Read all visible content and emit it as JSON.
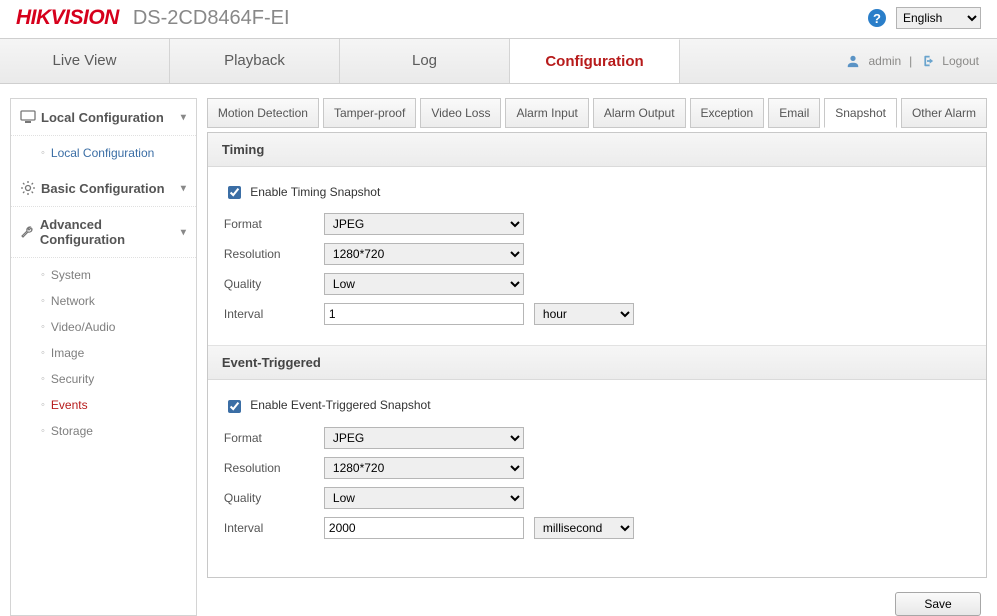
{
  "header": {
    "logo": "HIKVISION",
    "model": "DS-2CD8464F-EI",
    "language": "English",
    "help_tooltip": "?"
  },
  "nav": {
    "tabs": [
      "Live View",
      "Playback",
      "Log",
      "Configuration"
    ],
    "active_index": 3,
    "user": "admin",
    "logout": "Logout"
  },
  "sidebar": {
    "sections": [
      {
        "label": "Local Configuration",
        "items": [
          {
            "label": "Local Configuration",
            "link": true
          }
        ]
      },
      {
        "label": "Basic Configuration",
        "items": []
      },
      {
        "label": "Advanced Configuration",
        "items": [
          {
            "label": "System"
          },
          {
            "label": "Network"
          },
          {
            "label": "Video/Audio"
          },
          {
            "label": "Image"
          },
          {
            "label": "Security"
          },
          {
            "label": "Events",
            "active": true
          },
          {
            "label": "Storage"
          }
        ]
      }
    ]
  },
  "subtabs": {
    "items": [
      "Motion Detection",
      "Tamper-proof",
      "Video Loss",
      "Alarm Input",
      "Alarm Output",
      "Exception",
      "Email",
      "Snapshot",
      "Other Alarm"
    ],
    "active_index": 7
  },
  "sections": {
    "timing": {
      "title": "Timing",
      "enable_label": "Enable Timing Snapshot",
      "enable_checked": true,
      "format_label": "Format",
      "format_value": "JPEG",
      "resolution_label": "Resolution",
      "resolution_value": "1280*720",
      "quality_label": "Quality",
      "quality_value": "Low",
      "interval_label": "Interval",
      "interval_value": "1",
      "interval_unit": "hour"
    },
    "event": {
      "title": "Event-Triggered",
      "enable_label": "Enable Event-Triggered Snapshot",
      "enable_checked": true,
      "format_label": "Format",
      "format_value": "JPEG",
      "resolution_label": "Resolution",
      "resolution_value": "1280*720",
      "quality_label": "Quality",
      "quality_value": "Low",
      "interval_label": "Interval",
      "interval_value": "2000",
      "interval_unit": "millisecond"
    }
  },
  "save_label": "Save"
}
